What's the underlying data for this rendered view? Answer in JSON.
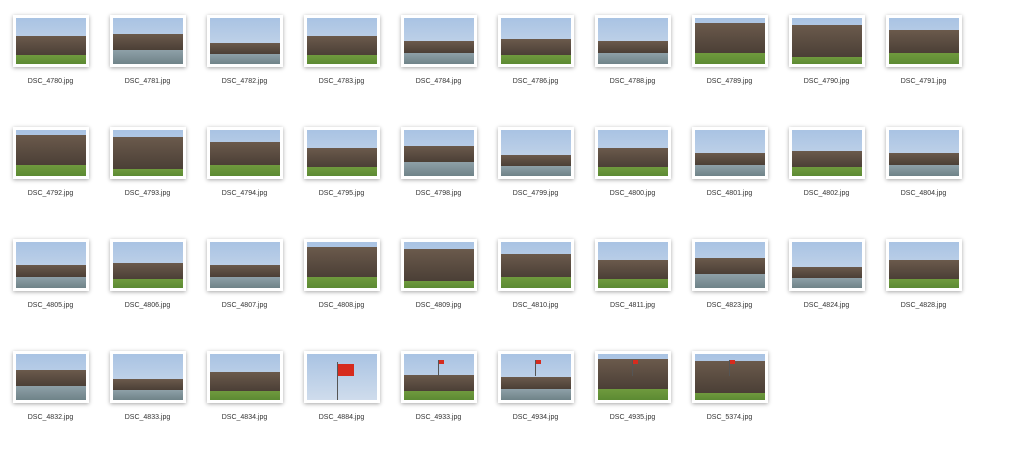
{
  "files": [
    "DSC_4780.jpg",
    "DSC_4781.jpg",
    "DSC_4782.jpg",
    "DSC_4783.jpg",
    "DSC_4784.jpg",
    "DSC_4786.jpg",
    "DSC_4788.jpg",
    "DSC_4789.jpg",
    "DSC_4790.jpg",
    "DSC_4791.jpg",
    "DSC_4792.jpg",
    "DSC_4793.jpg",
    "DSC_4794.jpg",
    "DSC_4795.jpg",
    "DSC_4798.jpg",
    "DSC_4799.jpg",
    "DSC_4800.jpg",
    "DSC_4801.jpg",
    "DSC_4802.jpg",
    "DSC_4804.jpg",
    "DSC_4805.jpg",
    "DSC_4806.jpg",
    "DSC_4807.jpg",
    "DSC_4808.jpg",
    "DSC_4809.jpg",
    "DSC_4810.jpg",
    "DSC_4811.jpg",
    "DSC_4823.jpg",
    "DSC_4824.jpg",
    "DSC_4828.jpg",
    "DSC_4832.jpg",
    "DSC_4833.jpg",
    "DSC_4834.jpg",
    "DSC_4884.jpg",
    "DSC_4933.jpg",
    "DSC_4934.jpg",
    "DSC_4935.jpg",
    "DSC_5374.jpg"
  ]
}
